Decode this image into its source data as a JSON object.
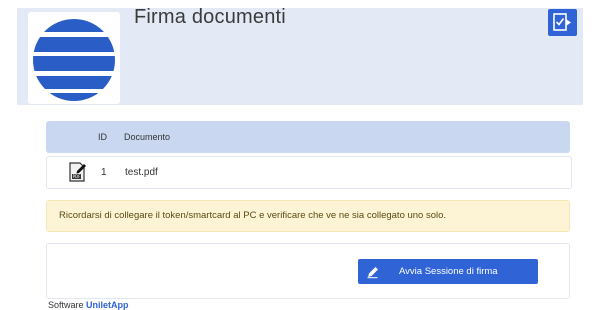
{
  "header": {
    "title": "Firma documenti",
    "logo_icon": "striped-globe-logo",
    "exit_icon": "sign-exit-icon"
  },
  "table": {
    "columns": [
      "ID",
      "Documento"
    ],
    "rows": [
      {
        "icon": "pdf-sign-icon",
        "id": "1",
        "document": "test.pdf"
      }
    ]
  },
  "alert": {
    "text": "Ricordarsi di collegare il token/smartcard al PC e verificare che ve ne sia collegato uno solo."
  },
  "actions": {
    "start_button_label": "Avvia Sessione di firma",
    "start_button_icon": "pencil-icon"
  },
  "footer": {
    "prefix": "Software",
    "brand": "UniletApp"
  },
  "colors": {
    "accent": "#2f63d6",
    "header_bg": "#e3eaf6",
    "table_header_bg": "#c9d8f0",
    "alert_bg": "#fdf4d6"
  }
}
